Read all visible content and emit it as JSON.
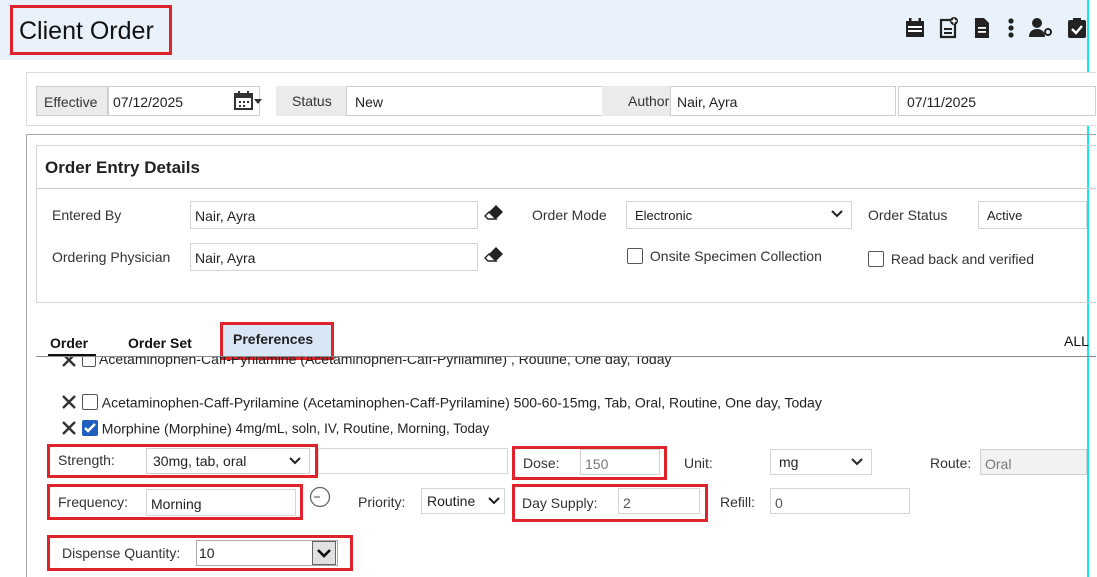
{
  "title": "Client Order",
  "header": {
    "effective_label": "Effective",
    "effective_value": "07/12/2025",
    "status_label": "Status",
    "status_value": "New",
    "author_label": "Author",
    "author_value": "Nair, Ayra",
    "date_value": "07/11/2025"
  },
  "details": {
    "title": "Order Entry Details",
    "entered_by_label": "Entered By",
    "entered_by_value": "Nair, Ayra",
    "ordering_physician_label": "Ordering Physician",
    "ordering_physician_value": "Nair, Ayra",
    "order_mode_label": "Order Mode",
    "order_mode_value": "Electronic",
    "order_status_label": "Order Status",
    "order_status_value": "Active",
    "onsite_label": "Onsite Specimen Collection",
    "readback_label": "Read back and verified"
  },
  "tabs": {
    "order": "Order",
    "order_set": "Order Set",
    "preferences": "Preferences",
    "all": "ALL"
  },
  "orders": {
    "cut_line": "Acetaminophen-Caff-Pyrilamine (Acetaminophen-Caff-Pyrilamine) , Routine, One day, Today",
    "item1": "Acetaminophen-Caff-Pyrilamine (Acetaminophen-Caff-Pyrilamine) 500-60-15mg, Tab, Oral, Routine, One day, Today",
    "item2_name": "Morphine (Morphine)",
    "item2_detail": "4mg/mL, soln, IV, Routine, Morning, Today"
  },
  "form": {
    "strength_label": "Strength:",
    "strength_value": "30mg, tab, oral",
    "dose_label": "Dose:",
    "dose_value": "150",
    "unit_label": "Unit:",
    "unit_value": "mg",
    "route_label": "Route:",
    "route_value": "Oral",
    "frequency_label": "Frequency:",
    "frequency_value": "Morning",
    "priority_label": "Priority:",
    "priority_value": "Routine",
    "day_supply_label": "Day Supply:",
    "day_supply_value": "2",
    "refill_label": "Refill:",
    "refill_value": "0",
    "dispense_label": "Dispense Quantity:",
    "dispense_value": "10"
  },
  "colors": {
    "highlight": "#e0232a",
    "titlebar": "#e9f2fb",
    "checkbox_checked": "#1f5fbf"
  },
  "icons": [
    "calendar-icon",
    "add-document-icon",
    "document-icon",
    "more-vertical-icon",
    "user-key-icon",
    "clipboard-check-icon"
  ]
}
